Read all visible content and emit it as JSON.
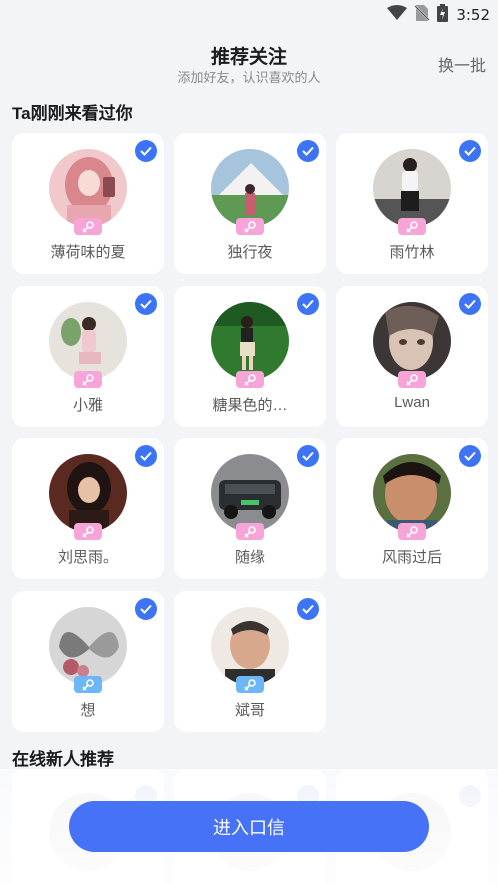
{
  "status_bar": {
    "time": "3:52",
    "icons": [
      "wifi-icon",
      "no-sim-icon",
      "battery-charging-icon"
    ]
  },
  "header": {
    "title": "推荐关注",
    "subtitle": "添加好友，认识喜欢的人",
    "refresh_label": "换一批"
  },
  "section_recent": {
    "title": "Ta刚刚来看过你"
  },
  "section_new": {
    "title": "在线新人推荐"
  },
  "users": [
    {
      "name": "薄荷味的夏",
      "gender": "female",
      "selected": true
    },
    {
      "name": "独行夜",
      "gender": "female",
      "selected": true
    },
    {
      "name": "雨竹林",
      "gender": "female",
      "selected": true
    },
    {
      "name": "小雅",
      "gender": "female",
      "selected": true
    },
    {
      "name": "糖果色的…",
      "gender": "female",
      "selected": true
    },
    {
      "name": "Lwan",
      "gender": "female",
      "selected": true
    },
    {
      "name": "刘思雨。",
      "gender": "female",
      "selected": true
    },
    {
      "name": "随缘",
      "gender": "female",
      "selected": true
    },
    {
      "name": "风雨过后",
      "gender": "female",
      "selected": true
    },
    {
      "name": "想",
      "gender": "male",
      "selected": true
    },
    {
      "name": "斌哥",
      "gender": "male",
      "selected": true
    }
  ],
  "enter_button": {
    "label": "进入口信"
  },
  "colors": {
    "accent": "#4672f7",
    "check": "#3d74f5",
    "female": "#f7a4d9",
    "male": "#6bb7f7",
    "background": "#f2f4f8"
  }
}
